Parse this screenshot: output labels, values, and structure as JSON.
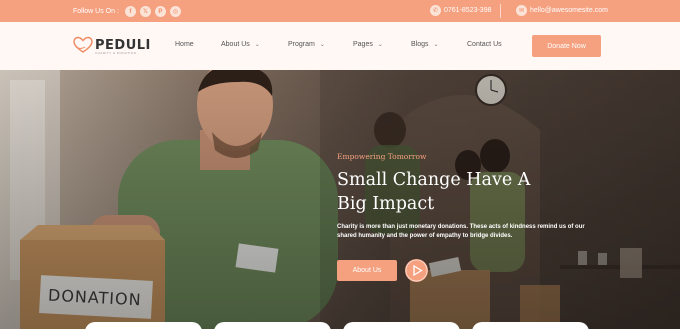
{
  "topbar": {
    "follow_label": "Follow Us On :",
    "social_icons": [
      "facebook-icon",
      "twitter-icon",
      "pinterest-icon",
      "instagram-icon"
    ],
    "phone": "0761-8523-398",
    "email": "hello@awesomesite.com",
    "background_color": "#f5a07f"
  },
  "logo": {
    "name": "PEDULI",
    "tagline": "CHARITY & DONATION"
  },
  "nav": {
    "items": [
      {
        "label": "Home",
        "has_dropdown": false
      },
      {
        "label": "About Us",
        "has_dropdown": true
      },
      {
        "label": "Program",
        "has_dropdown": true
      },
      {
        "label": "Pages",
        "has_dropdown": true
      },
      {
        "label": "Blogs",
        "has_dropdown": true
      },
      {
        "label": "Contact Us",
        "has_dropdown": false
      }
    ],
    "donate_label": "Donate Now"
  },
  "hero": {
    "eyebrow": "Empowering Tomorrow",
    "headline": "Small Change Have A Big Impact",
    "description": "Charity is more than just monetary donations. These acts of kindness remind us of our shared humanity and the power of empathy to bridge divides.",
    "button_label": "About Us",
    "box_label": "DONATION",
    "accent_color": "#f5a07f"
  }
}
